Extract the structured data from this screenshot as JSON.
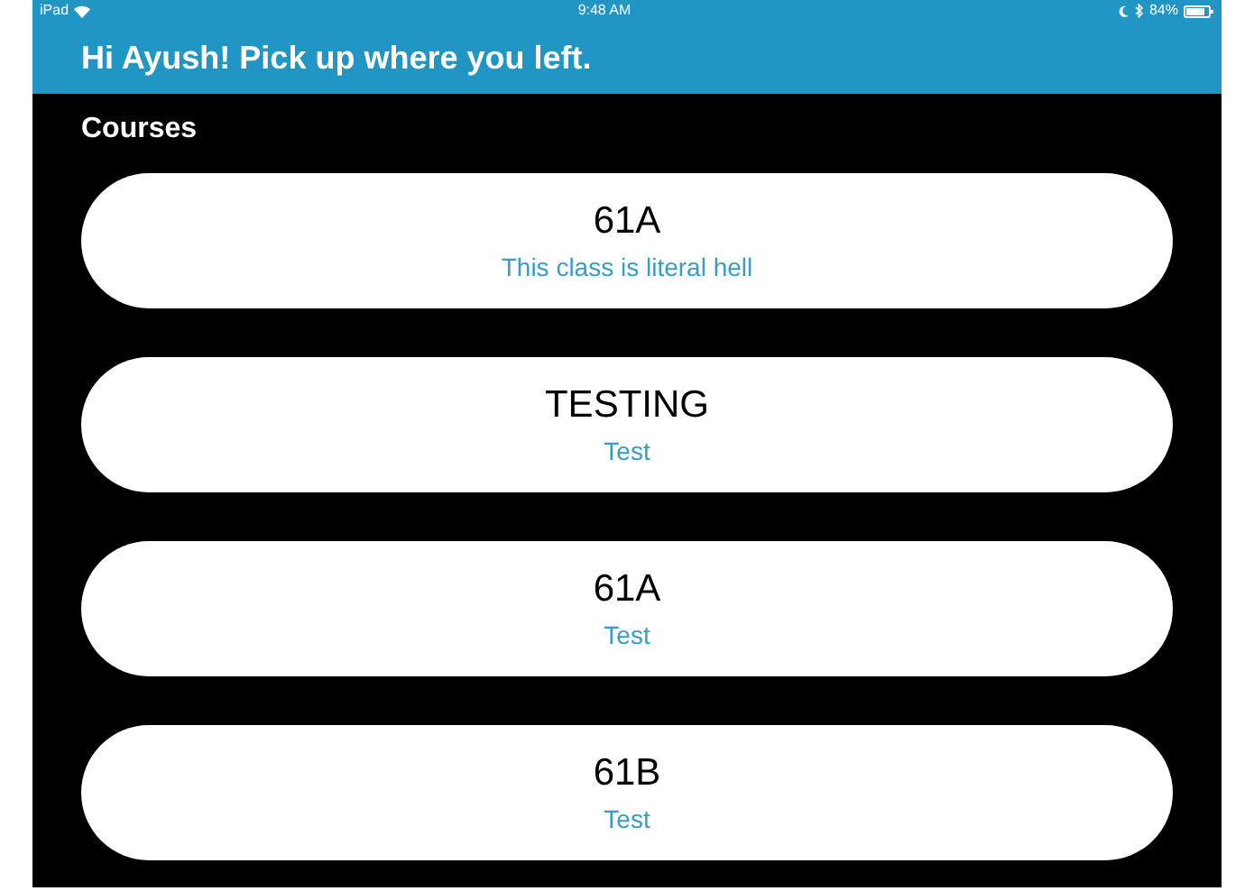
{
  "status_bar": {
    "device": "iPad",
    "time": "9:48 AM",
    "battery": "84%"
  },
  "header": {
    "title": "Hi Ayush! Pick up where you left."
  },
  "section": {
    "title": "Courses"
  },
  "courses": [
    {
      "name": "61A",
      "description": "This class is literal hell"
    },
    {
      "name": "TESTING",
      "description": "Test"
    },
    {
      "name": "61A",
      "description": "Test"
    },
    {
      "name": "61B",
      "description": "Test"
    }
  ]
}
